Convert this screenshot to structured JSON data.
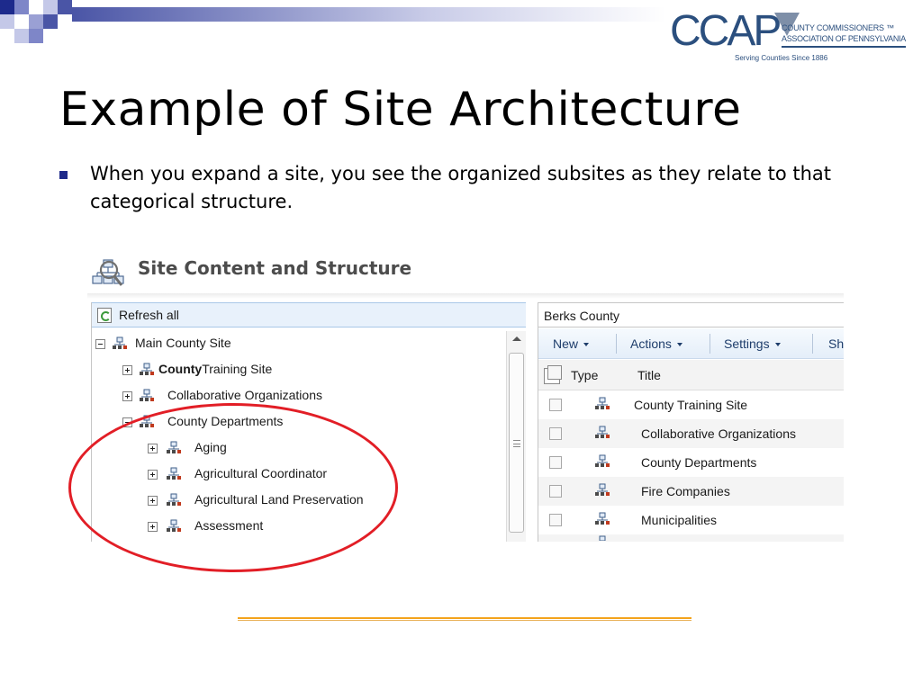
{
  "slide": {
    "title": "Example of Site Architecture",
    "bullet": "When you expand a site, you see the organized subsites as they relate to that categorical structure."
  },
  "logo": {
    "wordmark": "CCAP",
    "line1": "COUNTY COMMISSIONERS ™",
    "line2": "ASSOCIATION OF PENNSYLVANIA",
    "tagline": "Serving Counties Since 1886"
  },
  "screenshot": {
    "header_title": "Site Content and Structure",
    "refresh_label": "Refresh all",
    "tree": [
      {
        "label": "Main County Site",
        "bold_prefix": "",
        "depth": 0,
        "expanded": true
      },
      {
        "label": "Training Site",
        "bold_prefix": "County",
        "depth": 1,
        "expanded": false
      },
      {
        "label": "Collaborative Organizations",
        "bold_prefix": "",
        "depth": 1,
        "expanded": false
      },
      {
        "label": "County Departments",
        "bold_prefix": "",
        "depth": 1,
        "expanded": true
      },
      {
        "label": "Aging",
        "bold_prefix": "",
        "depth": 2,
        "expanded": false
      },
      {
        "label": "Agricultural Coordinator",
        "bold_prefix": "",
        "depth": 2,
        "expanded": false
      },
      {
        "label": "Agricultural Land Preservation",
        "bold_prefix": "",
        "depth": 2,
        "expanded": false
      },
      {
        "label": "Assessment",
        "bold_prefix": "",
        "depth": 2,
        "expanded": false
      }
    ],
    "right_header": "Berks County",
    "toolbar": {
      "new_label": "New",
      "actions_label": "Actions",
      "settings_label": "Settings",
      "overflow_label": "Sh"
    },
    "columns": {
      "type": "Type",
      "title": "Title"
    },
    "rows": [
      {
        "title": "County Training Site"
      },
      {
        "title": "Collaborative Organizations"
      },
      {
        "title": "County Departments"
      },
      {
        "title": "Fire Companies"
      },
      {
        "title": "Municipalities"
      }
    ]
  },
  "colors": {
    "annotation_ring": "#e21e26",
    "bullet": "#1f2a8a",
    "logo_blue": "#2b4f7e",
    "footer_rule": "#f3a31c"
  },
  "icons": [
    "site-hierarchy-icon",
    "refresh-icon",
    "expand-icon",
    "collapse-icon",
    "site-content-icon"
  ]
}
